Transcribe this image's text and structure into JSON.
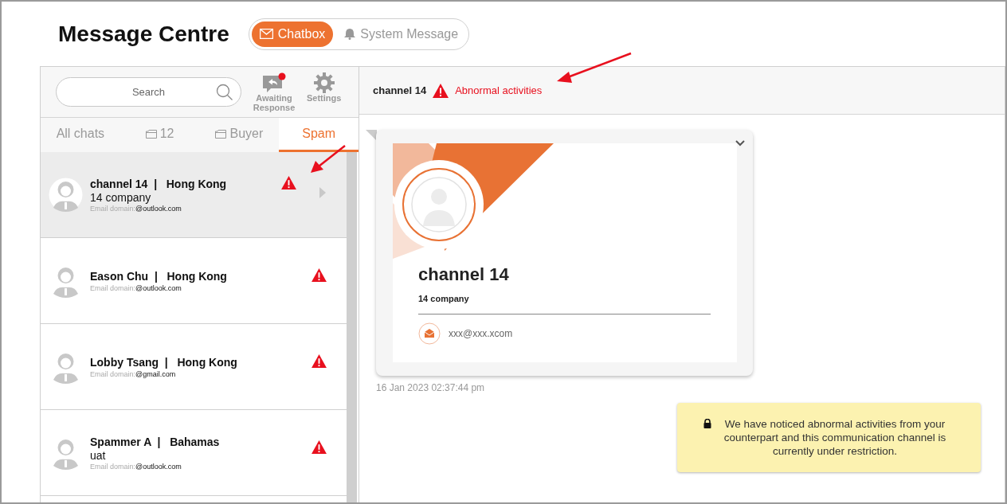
{
  "page_title": "Message Centre",
  "mode_tabs": [
    {
      "label": "Chatbox",
      "selected": true
    },
    {
      "label": "System Message",
      "selected": false
    }
  ],
  "search": {
    "placeholder": "Search"
  },
  "tools": [
    {
      "label": "Awaiting Response",
      "kind": "reply",
      "badge": true
    },
    {
      "label": "Settings",
      "kind": "settings",
      "badge": false
    }
  ],
  "filter_tabs": [
    {
      "label": "All chats",
      "folder": false,
      "selected": false
    },
    {
      "label": "12",
      "folder": true,
      "selected": false
    },
    {
      "label": "Buyer",
      "folder": true,
      "selected": false
    },
    {
      "label": "Spam",
      "folder": false,
      "selected": true
    }
  ],
  "chats": [
    {
      "name": "channel 14",
      "separator": "|",
      "location": "Hong Kong",
      "company": "14 company",
      "domain_label": "Email domain:",
      "domain": "@outlook.com",
      "warning": true,
      "selected": true
    },
    {
      "name": "Eason Chu",
      "separator": "|",
      "location": "Hong Kong",
      "domain_label": "Email domain:",
      "domain": "@outlook.com",
      "warning": true,
      "selected": false
    },
    {
      "name": "Lobby Tsang",
      "separator": "|",
      "location": "Hong Kong",
      "domain_label": "Email domain:",
      "domain": "@gmail.com",
      "warning": true,
      "selected": false
    },
    {
      "name": "Spammer A",
      "separator": "|",
      "location": "Bahamas",
      "company": "uat",
      "domain_label": "Email domain:",
      "domain": "@outlook.com",
      "warning": true,
      "selected": false
    }
  ],
  "conversation": {
    "title": "channel 14",
    "status": "Abnormal activities",
    "card": {
      "name": "channel 14",
      "company": "14 company",
      "email": "xxx@xxx.xcom"
    },
    "timestamp": "16 Jan 2023 02:37:44 pm",
    "notice": "We have noticed abnormal activities from your counterpart and this communication channel is currently under restriction."
  }
}
